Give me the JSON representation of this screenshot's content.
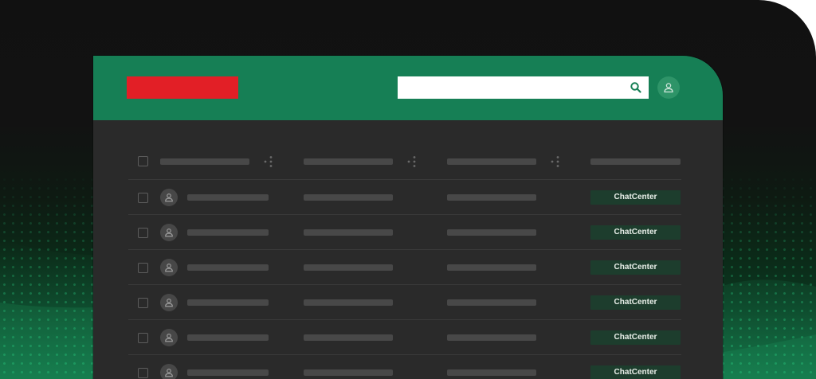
{
  "colors": {
    "header_bg": "#167f55",
    "logo_bg": "#e21f26",
    "panel_bg": "#2a2a2a",
    "placeholder": "#484848",
    "badge_bg": "#1d3d2d",
    "badge_text": "#e9efe9"
  },
  "header": {
    "logo_icon": "brand-logo-block",
    "search": {
      "value": "",
      "placeholder": "",
      "icon": "search-icon"
    },
    "profile_icon": "user-icon"
  },
  "table": {
    "header_icons": [
      "sort-icon",
      "sort-icon",
      "sort-icon"
    ],
    "rows": [
      {
        "tag": "ChatCenter",
        "avatar_icon": "user-icon"
      },
      {
        "tag": "ChatCenter",
        "avatar_icon": "user-icon"
      },
      {
        "tag": "ChatCenter",
        "avatar_icon": "user-icon"
      },
      {
        "tag": "ChatCenter",
        "avatar_icon": "user-icon"
      },
      {
        "tag": "ChatCenter",
        "avatar_icon": "user-icon"
      },
      {
        "tag": "ChatCenter",
        "avatar_icon": "user-icon"
      }
    ]
  }
}
